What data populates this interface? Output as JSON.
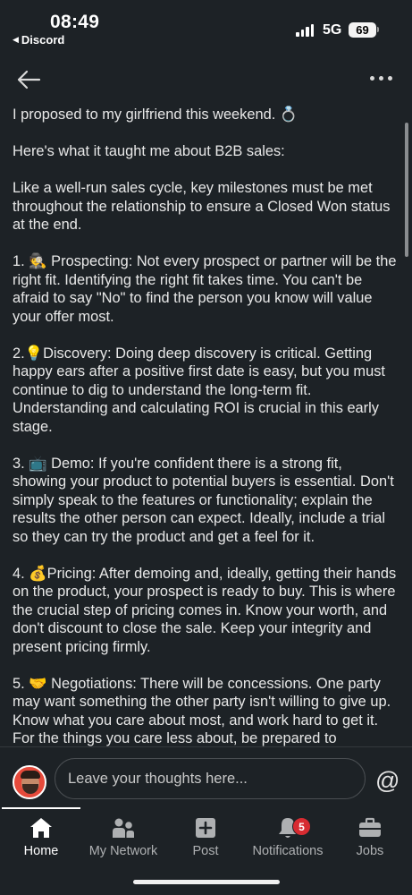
{
  "status_bar": {
    "time": "08:49",
    "back_app": "Discord",
    "network": "5G",
    "battery": "69"
  },
  "nav": {
    "back_icon": "arrow-left-icon",
    "more_icon": "more-horizontal-icon"
  },
  "post": {
    "paragraphs": [
      "I proposed to my girlfriend this weekend. 💍",
      "Here's what it taught me about B2B sales:",
      "Like a well-run sales cycle, key milestones must be met throughout the relationship to ensure a Closed Won status at the end.",
      "1. 🕵 Prospecting: Not every prospect or partner will be the right fit. Identifying the right fit takes time. You can't be afraid to say \"No\" to find the person you know will value your offer most.",
      "2.💡Discovery: Doing deep discovery is critical. Getting happy ears after a positive first date is easy, but you must continue to dig to understand the long-term fit. Understanding and calculating ROI is crucial in this early stage.",
      "3. 📺 Demo: If you're confident there is a strong fit, showing your product to potential buyers is essential. Don't simply speak to the features or functionality; explain the results the other person can expect. Ideally, include a trial so they can try the product and get a feel for it.",
      "4. 💰Pricing: After demoing and, ideally, getting their hands on the product, your prospect is ready to buy. This is where the crucial step of pricing comes in. Know your worth, and don't discount to close the sale. Keep your integrity and present pricing firmly.",
      "5. 🤝 Negotiations: There will be concessions. One party may want something the other party isn't willing to give up. Know what you care about most, and work hard to get it. For the things you care less about, be prepared to"
    ]
  },
  "comment": {
    "placeholder": "Leave your thoughts here...",
    "at_symbol": "@"
  },
  "tabs": [
    {
      "label": "Home",
      "icon": "home-icon",
      "active": true
    },
    {
      "label": "My Network",
      "icon": "network-icon",
      "active": false
    },
    {
      "label": "Post",
      "icon": "post-plus-icon",
      "active": false
    },
    {
      "label": "Notifications",
      "icon": "bell-icon",
      "active": false,
      "badge": "5"
    },
    {
      "label": "Jobs",
      "icon": "briefcase-icon",
      "active": false
    }
  ]
}
